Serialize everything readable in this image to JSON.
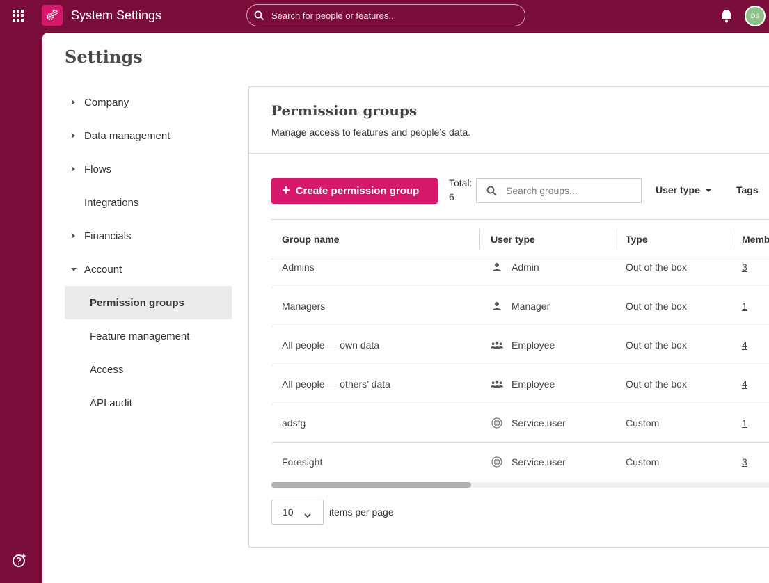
{
  "topbar": {
    "app_title": "System Settings",
    "search_placeholder": "Search for people or features...",
    "avatar_initials": "DS"
  },
  "page": {
    "title": "Settings"
  },
  "sidebar": {
    "items": [
      {
        "label": "Company",
        "caret": "right"
      },
      {
        "label": "Data management",
        "caret": "right"
      },
      {
        "label": "Flows",
        "caret": "right"
      },
      {
        "label": "Integrations",
        "caret": "none"
      },
      {
        "label": "Financials",
        "caret": "right"
      },
      {
        "label": "Account",
        "caret": "down"
      },
      {
        "label": "Permission groups",
        "active": true
      },
      {
        "label": "Feature management"
      },
      {
        "label": "Access"
      },
      {
        "label": "API audit"
      }
    ]
  },
  "panel": {
    "title": "Permission groups",
    "subtitle": "Manage access to features and people’s data.",
    "create_button": "Create permission group",
    "total_label": "Total:",
    "total_value": "6",
    "search_placeholder": "Search groups...",
    "filters": {
      "user_type": "User type",
      "tags": "Tags"
    }
  },
  "table": {
    "columns": [
      "Group name",
      "User type",
      "Type",
      "Members"
    ],
    "rows": [
      {
        "name": "Admins",
        "user_type": "Admin",
        "icon": "person-icon",
        "type": "Out of the box",
        "members": "3"
      },
      {
        "name": "Managers",
        "user_type": "Manager",
        "icon": "person-icon",
        "type": "Out of the box",
        "members": "1"
      },
      {
        "name": "All people — own data",
        "user_type": "Employee",
        "icon": "people-group-icon",
        "type": "Out of the box",
        "members": "4"
      },
      {
        "name": "All people — others’ data",
        "user_type": "Employee",
        "icon": "people-group-icon",
        "type": "Out of the box",
        "members": "4"
      },
      {
        "name": "adsfg",
        "user_type": "Service user",
        "icon": "robot-icon",
        "type": "Custom",
        "members": "1"
      },
      {
        "name": "Foresight",
        "user_type": "Service user",
        "icon": "robot-icon",
        "type": "Custom",
        "members": "3"
      }
    ]
  },
  "pagination": {
    "per_page_value": "10",
    "per_page_label": "items per page"
  },
  "colors": {
    "brand": "#7a0d3a",
    "accent": "#d6186d"
  }
}
